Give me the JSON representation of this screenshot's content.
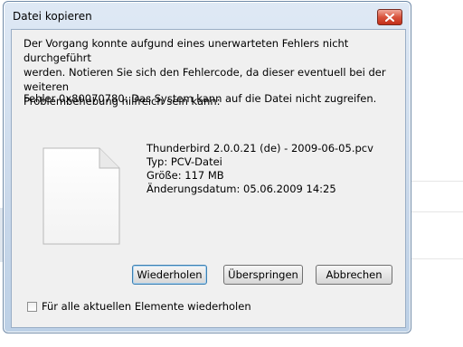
{
  "window": {
    "title": "Datei kopieren",
    "close_icon": "close-icon"
  },
  "message": {
    "text": "Der Vorgang konnte aufgund eines unerwarteten Fehlers nicht durchgeführt\nwerden. Notieren Sie sich den Fehlercode, da dieser eventuell bei der weiteren\nProblembehebung hilfreich sein kann:",
    "error": "Fehler 0x80070780: Das System kann auf die Datei nicht zugreifen."
  },
  "file": {
    "icon": "document-icon",
    "name": "Thunderbird 2.0.0.21 (de) - 2009-06-05.pcv",
    "type": "Typ: PCV-Datei",
    "size": "Größe: 117 MB",
    "modified": "Änderungsdatum: 05.06.2009 14:25"
  },
  "buttons": {
    "retry": "Wiederholen",
    "skip": "Überspringen",
    "cancel": "Abbrechen"
  },
  "repeat_checkbox": {
    "label": "Für alle aktuellen Elemente wiederholen",
    "checked": false
  }
}
